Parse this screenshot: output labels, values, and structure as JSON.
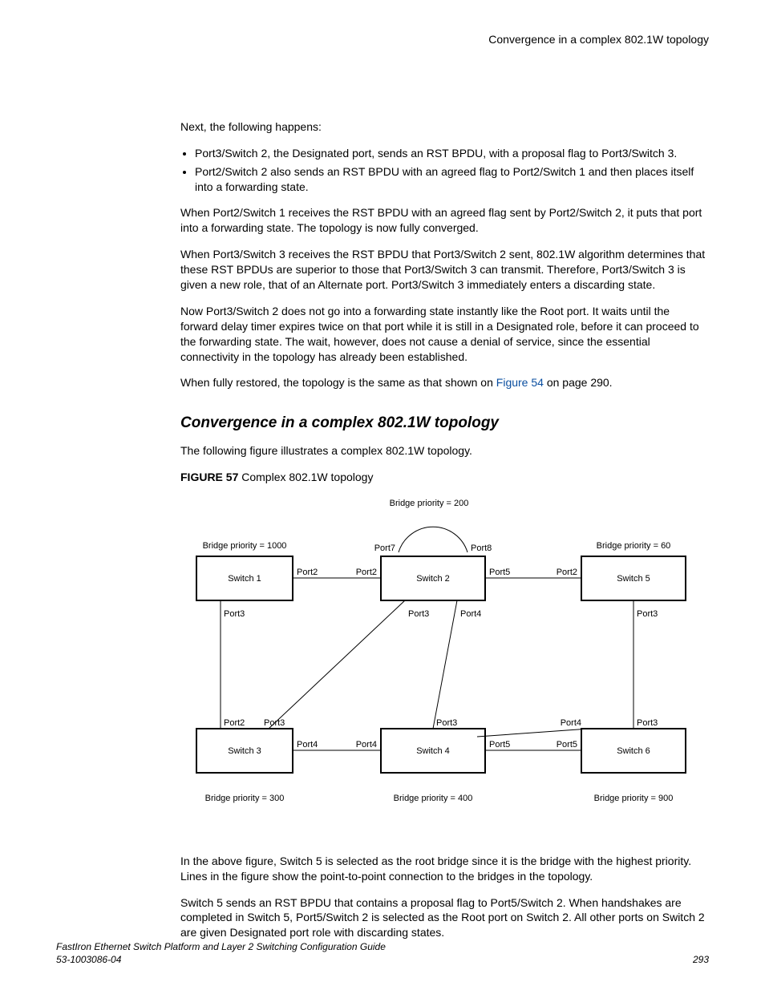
{
  "running_header": "Convergence in a complex 802.1W topology",
  "intro": "Next, the following happens:",
  "bullets": [
    "Port3/Switch 2, the Designated port, sends an RST BPDU, with a proposal flag to Port3/Switch 3.",
    "Port2/Switch 2 also sends an RST BPDU with an agreed flag to Port2/Switch 1 and then places itself into a forwarding state."
  ],
  "p1": "When Port2/Switch 1 receives the RST BPDU with an agreed flag sent by Port2/Switch 2, it puts that port into a forwarding state. The topology is now fully converged.",
  "p2": "When Port3/Switch 3 receives the RST BPDU that Port3/Switch 2 sent, 802.1W algorithm determines that these RST BPDUs are superior to those that Port3/Switch 3 can transmit. Therefore, Port3/Switch 3 is given a new role, that of an Alternate port. Port3/Switch 3 immediately enters a discarding state.",
  "p3": "Now Port3/Switch 2 does not go into a forwarding state instantly like the Root port. It waits until the forward delay timer expires twice on that port while it is still in a Designated role, before it can proceed to the forwarding state. The wait, however, does not cause a denial of service, since the essential connectivity in the topology has already been established.",
  "p4a": "When fully restored, the topology is the same as that shown on ",
  "p4_link": "Figure 54",
  "p4b": " on page 290.",
  "section_heading": "Convergence in a complex 802.1W topology",
  "section_intro": "The following figure illustrates a complex 802.1W topology.",
  "fig_label": "FIGURE 57",
  "fig_title": " Complex 802.1W topology",
  "chart_data": {
    "type": "diagram",
    "title": "Complex 802.1W topology",
    "nodes": [
      {
        "id": "s1",
        "name": "Switch 1",
        "priority_label": "Bridge priority = 1000",
        "priority": 1000
      },
      {
        "id": "s2",
        "name": "Switch 2",
        "priority_label": "Bridge priority = 200",
        "priority": 200,
        "root": true
      },
      {
        "id": "s3",
        "name": "Switch 3",
        "priority_label": "Bridge priority = 300",
        "priority": 300
      },
      {
        "id": "s4",
        "name": "Switch 4",
        "priority_label": "Bridge priority = 400",
        "priority": 400
      },
      {
        "id": "s5",
        "name": "Switch 5",
        "priority_label": "Bridge priority = 60",
        "priority": 60
      },
      {
        "id": "s6",
        "name": "Switch 6",
        "priority_label": "Bridge priority = 900",
        "priority": 900
      }
    ],
    "edges": [
      {
        "from": "s2",
        "from_port": "Port7",
        "to": "s2",
        "to_port": "Port8",
        "note": "self-loop arc at top of Switch 2"
      },
      {
        "from": "s1",
        "from_port": "Port2",
        "to": "s2",
        "to_port": "Port2"
      },
      {
        "from": "s2",
        "from_port": "Port5",
        "to": "s5",
        "to_port": "Port2"
      },
      {
        "from": "s1",
        "from_port": "Port3",
        "to": "s3",
        "to_port": "Port2"
      },
      {
        "from": "s2",
        "from_port": "Port3",
        "to": "s3",
        "to_port": "Port3"
      },
      {
        "from": "s2",
        "from_port": "Port4",
        "to": "s4",
        "to_port": "Port3"
      },
      {
        "from": "s5",
        "from_port": "Port3",
        "to": "s6",
        "to_port": "Port3"
      },
      {
        "from": "s3",
        "from_port": "Port4",
        "to": "s4",
        "to_port": "Port4"
      },
      {
        "from": "s4",
        "from_port": "Port5",
        "to": "s6",
        "to_port": "Port5"
      },
      {
        "from": "s6",
        "from_port": "Port4",
        "to": "s4",
        "to_port": "near Port3 (diagonal from Switch 6)",
        "note": "diagonal link numbered Port4 on Switch 6 side"
      }
    ]
  },
  "after1": "In the above figure, Switch 5 is selected as the root bridge since it is the bridge with the highest priority. Lines in the figure show the point-to-point connection to the bridges in the topology.",
  "after2": "Switch 5 sends an RST BPDU that contains a proposal flag to Port5/Switch 2. When handshakes are completed in Switch 5, Port5/Switch 2 is selected as the Root port on Switch 2. All other ports on Switch 2 are given Designated port role with discarding states.",
  "footer_title": "FastIron Ethernet Switch Platform and Layer 2 Switching Configuration Guide",
  "footer_doc": "53-1003086-04",
  "footer_page": "293"
}
